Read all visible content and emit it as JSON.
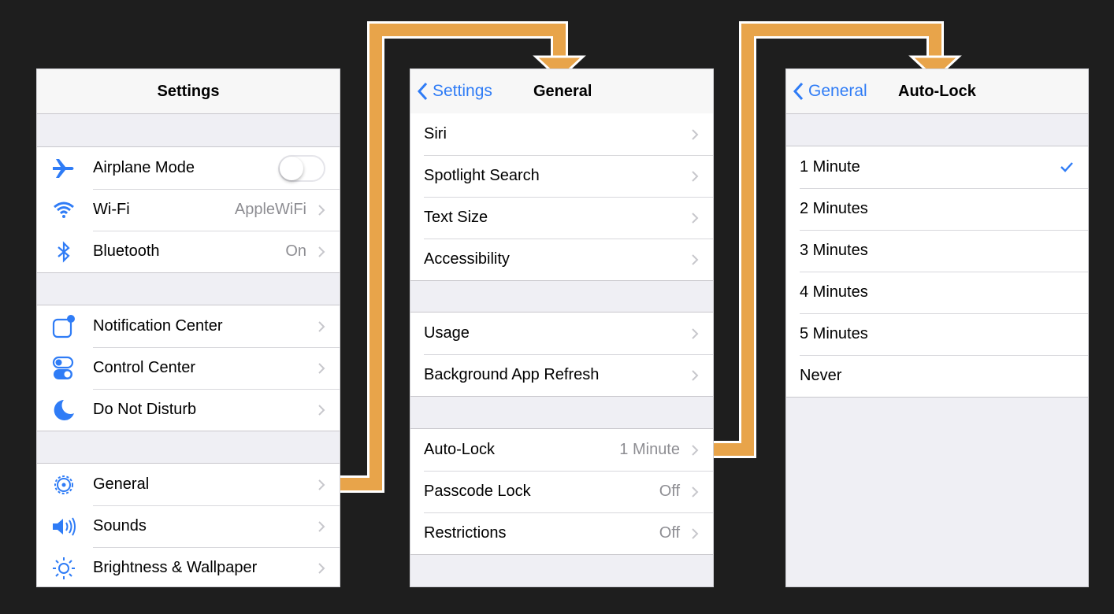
{
  "colors": {
    "accent": "#2f7cf6",
    "connector": "#e8a44a",
    "background": "#1e1e1e"
  },
  "settings": {
    "title": "Settings",
    "groups": [
      [
        {
          "label": "Airplane Mode",
          "icon": "airplane-icon",
          "toggle": "off"
        },
        {
          "label": "Wi-Fi",
          "icon": "wifi-icon",
          "value": "AppleWiFi"
        },
        {
          "label": "Bluetooth",
          "icon": "bluetooth-icon",
          "value": "On"
        }
      ],
      [
        {
          "label": "Notification Center",
          "icon": "notification-center-icon"
        },
        {
          "label": "Control Center",
          "icon": "control-center-icon"
        },
        {
          "label": "Do Not Disturb",
          "icon": "moon-icon"
        }
      ],
      [
        {
          "label": "General",
          "icon": "gear-icon"
        },
        {
          "label": "Sounds",
          "icon": "speaker-icon"
        },
        {
          "label": "Brightness & Wallpaper",
          "icon": "sun-icon"
        }
      ]
    ]
  },
  "general": {
    "back_label": "Settings",
    "title": "General",
    "groups": [
      [
        {
          "label": "Siri"
        },
        {
          "label": "Spotlight Search"
        },
        {
          "label": "Text Size"
        },
        {
          "label": "Accessibility"
        }
      ],
      [
        {
          "label": "Usage"
        },
        {
          "label": "Background App Refresh"
        }
      ],
      [
        {
          "label": "Auto-Lock",
          "value": "1 Minute"
        },
        {
          "label": "Passcode Lock",
          "value": "Off"
        },
        {
          "label": "Restrictions",
          "value": "Off"
        }
      ]
    ]
  },
  "autolock": {
    "back_label": "General",
    "title": "Auto-Lock",
    "options": [
      "1 Minute",
      "2 Minutes",
      "3 Minutes",
      "4 Minutes",
      "5 Minutes",
      "Never"
    ],
    "selected": "1 Minute"
  }
}
